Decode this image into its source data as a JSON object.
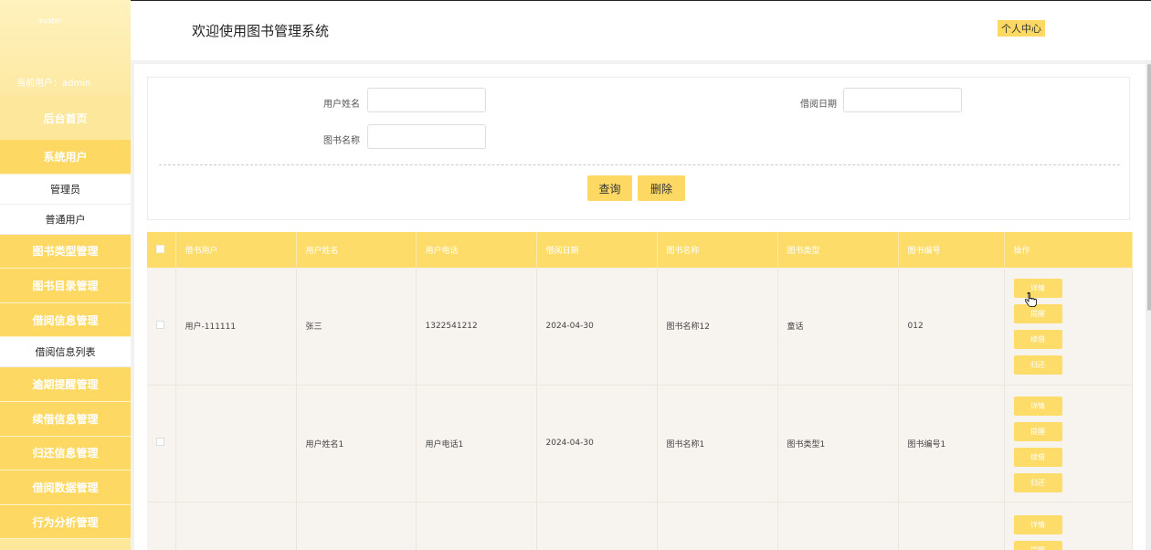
{
  "header": {
    "title": "欢迎使用图书管理系统",
    "personal_center": "个人中心"
  },
  "sidebar": {
    "avatar_alt": "avatar",
    "current_user": "当前用户：admin",
    "home": "后台首页",
    "menus": [
      {
        "label": "系统用户",
        "children": [
          "管理员",
          "普通用户"
        ]
      },
      {
        "label": "图书类型管理",
        "children": []
      },
      {
        "label": "图书目录管理",
        "children": []
      },
      {
        "label": "借阅信息管理",
        "children": [
          "借阅信息列表"
        ]
      },
      {
        "label": "逾期提醒管理",
        "children": []
      },
      {
        "label": "续借信息管理",
        "children": []
      },
      {
        "label": "归还信息管理",
        "children": []
      },
      {
        "label": "借阅数据管理",
        "children": []
      },
      {
        "label": "行为分析管理",
        "children": []
      }
    ]
  },
  "search": {
    "labels": {
      "user_name": "用户姓名",
      "borrow_date": "借阅日期",
      "book_name": "图书名称"
    },
    "query_button": "查询",
    "delete_button": "删除"
  },
  "table": {
    "headers": [
      "借书用户",
      "用户姓名",
      "用户电话",
      "借阅日期",
      "图书名称",
      "图书类型",
      "图书编号",
      "操作"
    ],
    "rows": [
      [
        "用户-111111",
        "张三",
        "1322541212",
        "2024-04-30",
        "图书名称12",
        "童话",
        "012"
      ],
      [
        "",
        "用户姓名1",
        "用户电话1",
        "2024-04-30",
        "图书名称1",
        "图书类型1",
        "图书编号1"
      ],
      [
        "",
        "",
        "",
        "",
        "",
        "",
        ""
      ]
    ],
    "ops": [
      "详情",
      "提醒",
      "续借",
      "归还"
    ]
  },
  "colors": {
    "accent": "#fdd964",
    "header_bg": "#ffffff"
  },
  "icons": {
    "cursor": "hand-pointer-icon"
  }
}
